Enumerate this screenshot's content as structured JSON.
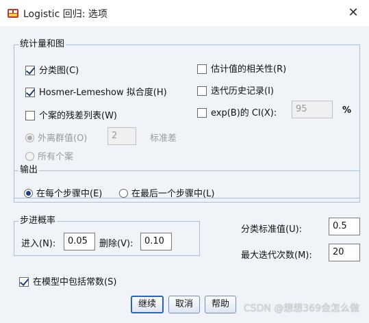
{
  "window": {
    "title": "Logistic 回归: 选项",
    "close_glyph": "✕"
  },
  "stats_group": {
    "legend": "统计量和图",
    "classification_plot": {
      "label": "分类图(C)",
      "checked": true
    },
    "hosmer_lemeshow": {
      "label": "Hosmer-Lemeshow 拟合度(H)",
      "checked": true
    },
    "casewise_list": {
      "label": "个案的残差列表(W)",
      "checked": false
    },
    "outliers": {
      "label": "外离群值(O)",
      "value": "2",
      "unit": "标准差",
      "selected": true,
      "enabled": false
    },
    "all_cases": {
      "label": "所有个案",
      "selected": false,
      "enabled": false
    },
    "correlations": {
      "label": "估计值的相关性(R)",
      "checked": false
    },
    "iteration_history": {
      "label": "迭代历史记录(I)",
      "checked": false
    },
    "ci_exp_b": {
      "label": "exp(B)的 CI(X):",
      "checked": false,
      "value": "95",
      "unit": "%"
    }
  },
  "display_group": {
    "legend": "输出",
    "each_step": {
      "label": "在每个步骤中(E)",
      "selected": true
    },
    "last_step": {
      "label": "在最后一个步骤中(L)",
      "selected": false
    }
  },
  "stepwise_group": {
    "legend": "步进概率",
    "entry_label": "进入(N):",
    "entry_value": "0.05",
    "removal_label": "删除(V):",
    "removal_value": "0.10"
  },
  "classification_cutoff": {
    "label": "分类标准值(U):",
    "value": "0.5"
  },
  "max_iterations": {
    "label": "最大迭代次数(M):",
    "value": "20"
  },
  "include_constant": {
    "label": "在模型中包括常数(S)",
    "checked": true
  },
  "buttons": {
    "continue": "继续",
    "cancel": "取消",
    "help": "帮助"
  },
  "watermark": "CSDN @想想369会怎么做"
}
